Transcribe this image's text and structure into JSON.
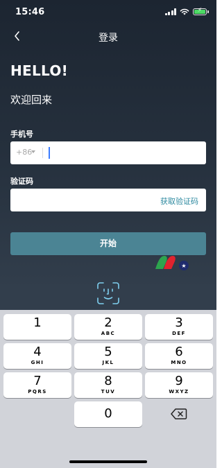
{
  "status_bar": {
    "time": "15:46"
  },
  "nav": {
    "title": "登录"
  },
  "hero": {
    "greeting": "HELLO!",
    "subtitle": "欢迎回来"
  },
  "phone": {
    "label": "手机号",
    "country_code": "+86",
    "value": ""
  },
  "code": {
    "label": "验证码",
    "value": "",
    "get_code_label": "获取验证码"
  },
  "start_button": {
    "label": "开始"
  },
  "colors": {
    "accent": "#4b8494",
    "link": "#2e8aa0",
    "battery": "#4cd964",
    "cursor": "#3b7cff"
  },
  "keypad": {
    "keys": [
      {
        "num": "1",
        "letters": ""
      },
      {
        "num": "2",
        "letters": "ABC"
      },
      {
        "num": "3",
        "letters": "DEF"
      },
      {
        "num": "4",
        "letters": "GHI"
      },
      {
        "num": "5",
        "letters": "JKL"
      },
      {
        "num": "6",
        "letters": "MNO"
      },
      {
        "num": "7",
        "letters": "PQRS"
      },
      {
        "num": "8",
        "letters": "TUV"
      },
      {
        "num": "9",
        "letters": "WXYZ"
      },
      {
        "num": "0",
        "letters": ""
      }
    ],
    "delete_icon": "backspace-icon"
  },
  "icons": [
    "cellular-signal-icon",
    "wifi-icon",
    "battery-charging-icon",
    "back-chevron-icon",
    "brand-logo",
    "face-id-icon"
  ]
}
